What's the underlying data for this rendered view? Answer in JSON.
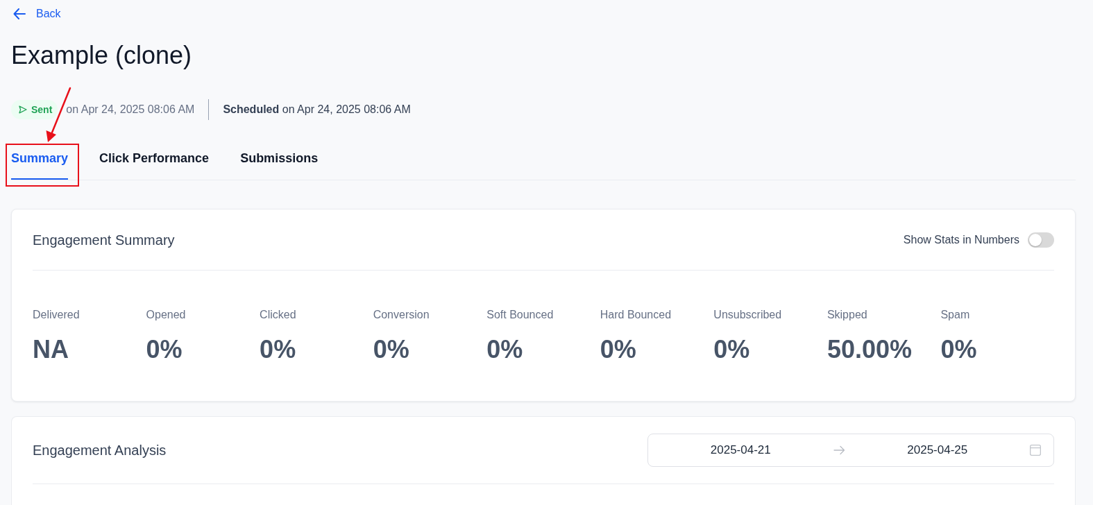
{
  "back_link": {
    "label": "Back"
  },
  "page_title": "Example (clone)",
  "status": {
    "badge": "Sent",
    "sent_time": "on Apr 24, 2025 08:06 AM",
    "scheduled_label": "Scheduled",
    "scheduled_time": "on Apr 24, 2025 08:06 AM"
  },
  "tabs": [
    {
      "label": "Summary",
      "selected": true,
      "highlighted": true
    },
    {
      "label": "Click Performance",
      "selected": false,
      "highlighted": false
    },
    {
      "label": "Submissions",
      "selected": false,
      "highlighted": false
    }
  ],
  "engagement_summary": {
    "title": "Engagement Summary",
    "toggle": {
      "label": "Show Stats in Numbers",
      "on": false
    },
    "stats": [
      {
        "label": "Delivered",
        "value": "NA"
      },
      {
        "label": "Opened",
        "value": "0%"
      },
      {
        "label": "Clicked",
        "value": "0%"
      },
      {
        "label": "Conversion",
        "value": "0%"
      },
      {
        "label": "Soft Bounced",
        "value": "0%"
      },
      {
        "label": "Hard Bounced",
        "value": "0%"
      },
      {
        "label": "Unsubscribed",
        "value": "0%"
      },
      {
        "label": "Skipped",
        "value": "50.00%"
      },
      {
        "label": "Spam",
        "value": "0%"
      }
    ]
  },
  "engagement_analysis": {
    "title": "Engagement Analysis",
    "date_range": {
      "start": "2025-04-21",
      "end": "2025-04-25"
    }
  }
}
